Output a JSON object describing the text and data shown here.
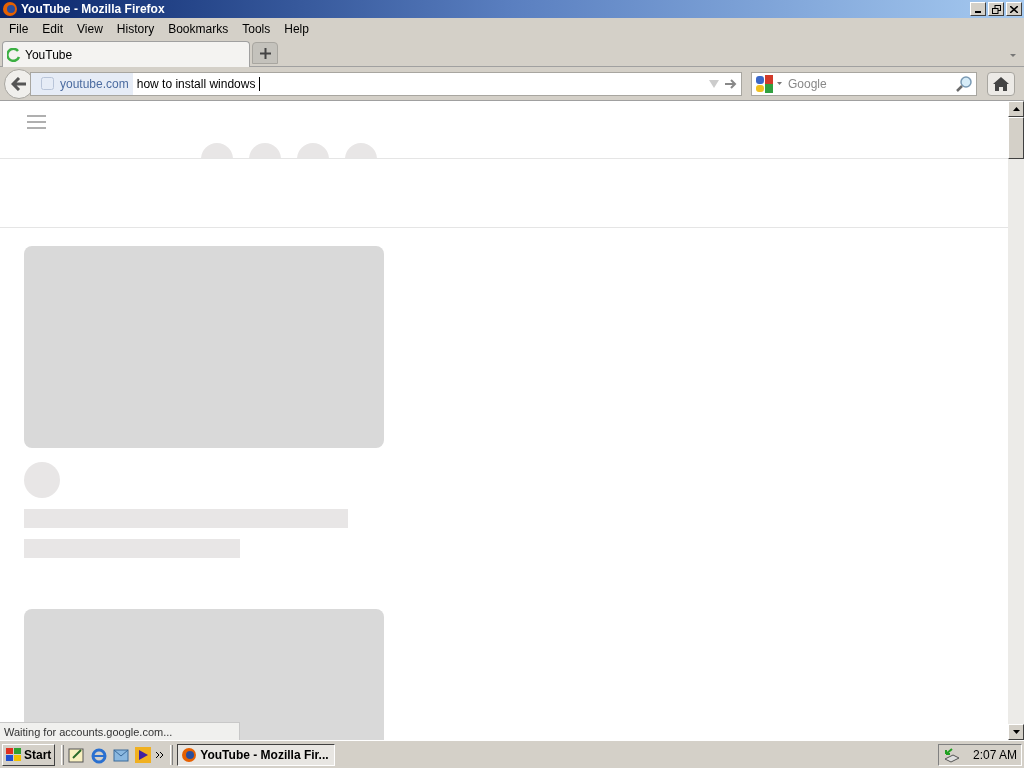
{
  "window": {
    "title": "YouTube - Mozilla Firefox"
  },
  "menu": [
    "File",
    "Edit",
    "View",
    "History",
    "Bookmarks",
    "Tools",
    "Help"
  ],
  "tabs": [
    {
      "label": "YouTube",
      "selected": true
    }
  ],
  "address_bar": {
    "domain": "youtube.com",
    "value": "how to install windows "
  },
  "search": {
    "placeholder": "Google"
  },
  "status_bar": {
    "text": "Waiting for accounts.google.com..."
  },
  "taskbar": {
    "start": "Start",
    "tasks": [
      {
        "label": "YouTube - Mozilla Fir...",
        "selected": true
      }
    ],
    "clock": "2:07 AM"
  }
}
